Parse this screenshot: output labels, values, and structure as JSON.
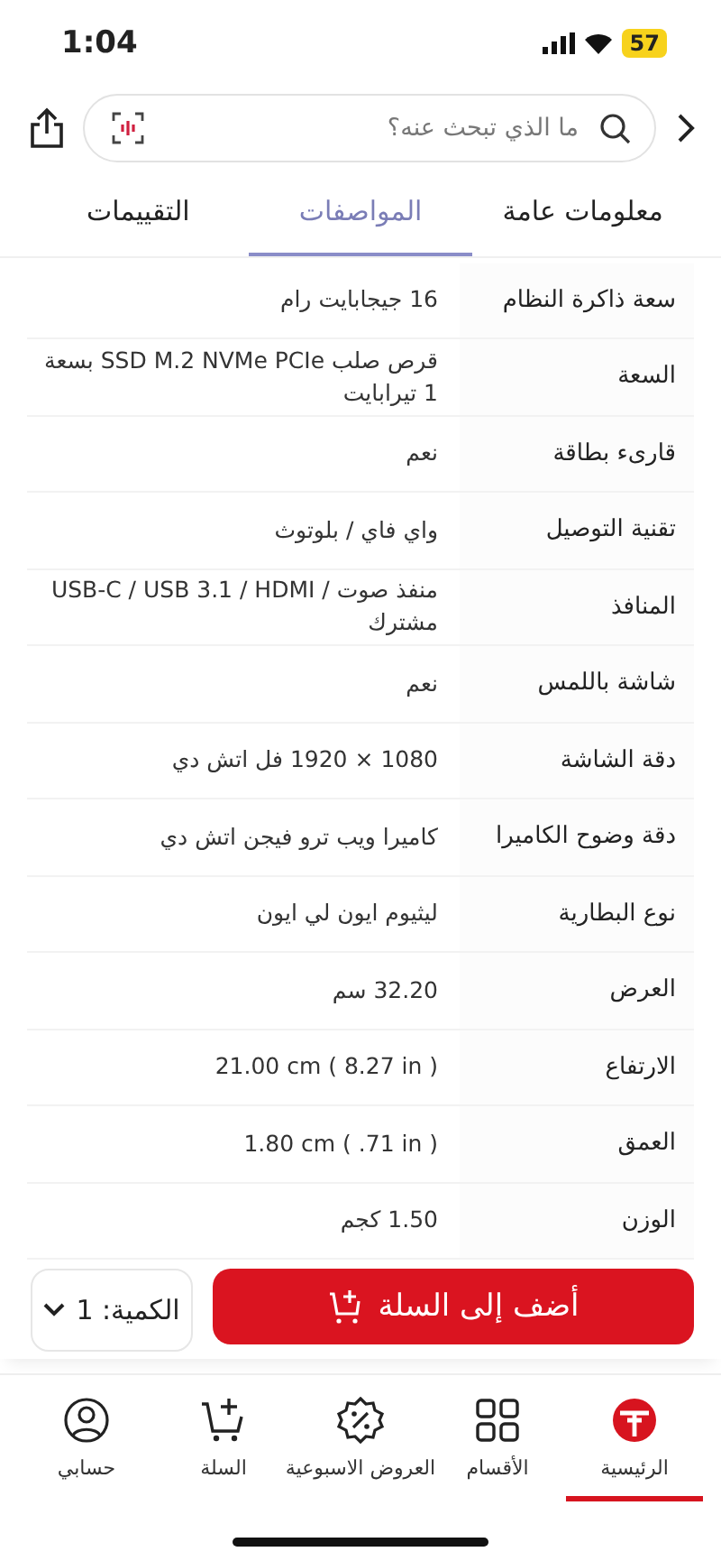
{
  "status_bar": {
    "time": "1:04",
    "battery": "57"
  },
  "search": {
    "placeholder": "ما الذي تبحث عنه؟"
  },
  "tabs": [
    {
      "label": "معلومات عامة",
      "selected": false
    },
    {
      "label": "المواصفات",
      "selected": true
    },
    {
      "label": "التقييمات",
      "selected": false
    }
  ],
  "specs": [
    {
      "label": "سعة ذاكرة النظام",
      "value": "16 جيجابايت رام"
    },
    {
      "label": "السعة",
      "value": "قرص صلب SSD M.2 NVMe PCIe بسعة 1 تيرابايت"
    },
    {
      "label": "قارىء بطاقة",
      "value": "نعم"
    },
    {
      "label": "تقنية التوصيل",
      "value": "واي فاي / بلوتوث"
    },
    {
      "label": "المنافذ",
      "value": "USB-C / USB 3.1 / HDMI / منفذ صوت مشترك"
    },
    {
      "label": "شاشة باللمس",
      "value": "نعم"
    },
    {
      "label": "دقة الشاشة",
      "value": "1080 × 1920 فل اتش دي"
    },
    {
      "label": "دقة وضوح الكاميرا",
      "value": "كاميرا ويب ترو فيجن اتش دي"
    },
    {
      "label": "نوع البطارية",
      "value": "ليثيوم ايون لي ايون"
    },
    {
      "label": "العرض",
      "value": "32.20 سم"
    },
    {
      "label": "الارتفاع",
      "value": "21.00 cm ( 8.27 in )"
    },
    {
      "label": "العمق",
      "value": "1.80 cm ( .71 in )"
    },
    {
      "label": "الوزن",
      "value": "1.50 كجم"
    }
  ],
  "quantity": {
    "label": "الكمية: 1"
  },
  "add_to_cart": {
    "label": "أضف إلى السلة"
  },
  "nav": [
    {
      "kind": "home",
      "label": "الرئيسية",
      "selected": true
    },
    {
      "kind": "grid",
      "label": "الأقسام",
      "selected": false
    },
    {
      "kind": "offers",
      "label": "العروض الاسبوعية",
      "selected": false
    },
    {
      "kind": "cart",
      "label": "السلة",
      "selected": false
    },
    {
      "kind": "account",
      "label": "حسابي",
      "selected": false
    }
  ]
}
